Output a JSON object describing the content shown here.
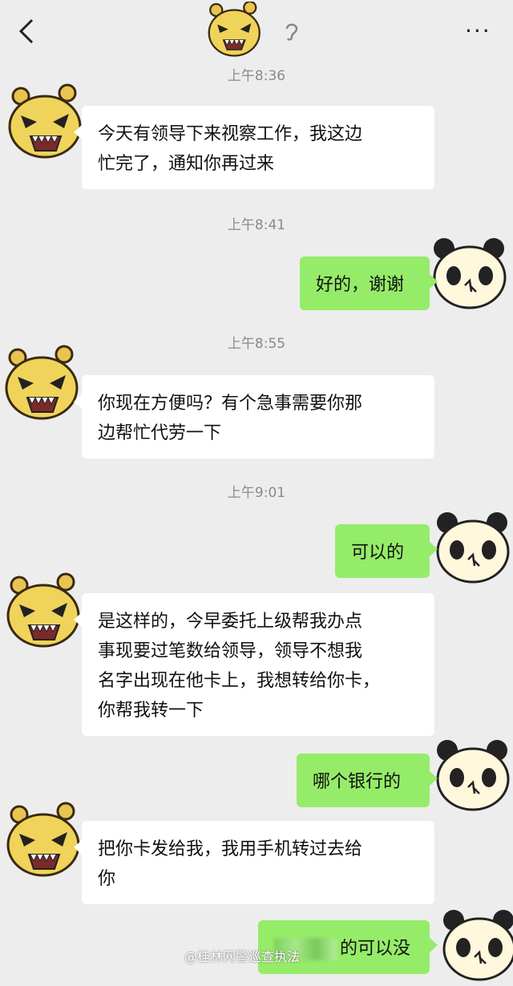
{
  "header": {
    "back_icon": "chevron-left-icon",
    "voice_icon": "ear-icon",
    "more_label": "···"
  },
  "messages": [
    {
      "type": "time",
      "text": "上午8:36"
    },
    {
      "type": "in",
      "text": "今天有领导下来视察工作，我这边\n忙完了，通知你再过来"
    },
    {
      "type": "time",
      "text": "上午8:41"
    },
    {
      "type": "out",
      "text": "好的，谢谢"
    },
    {
      "type": "time",
      "text": "上午8:55"
    },
    {
      "type": "in",
      "text": "你现在方便吗？有个急事需要你那\n边帮忙代劳一下"
    },
    {
      "type": "time",
      "text": "上午9:01"
    },
    {
      "type": "out",
      "text": "可以的"
    },
    {
      "type": "in",
      "text": "是这样的，今早委托上级帮我办点\n事现要过笔数给领导，领导不想我\n名字出现在他卡上，我想转给你卡，\n你帮我转一下"
    },
    {
      "type": "out",
      "text": "哪个银行的"
    },
    {
      "type": "in",
      "text": "把你卡发给我，我用手机转过去给\n你"
    },
    {
      "type": "out",
      "text": "的可以没"
    }
  ],
  "watermark": "@桂林网警巡查执法",
  "colors": {
    "background": "#ededed",
    "incoming_bubble": "#ffffff",
    "outgoing_bubble": "#95ec69",
    "timestamp": "#8a8a8a"
  }
}
